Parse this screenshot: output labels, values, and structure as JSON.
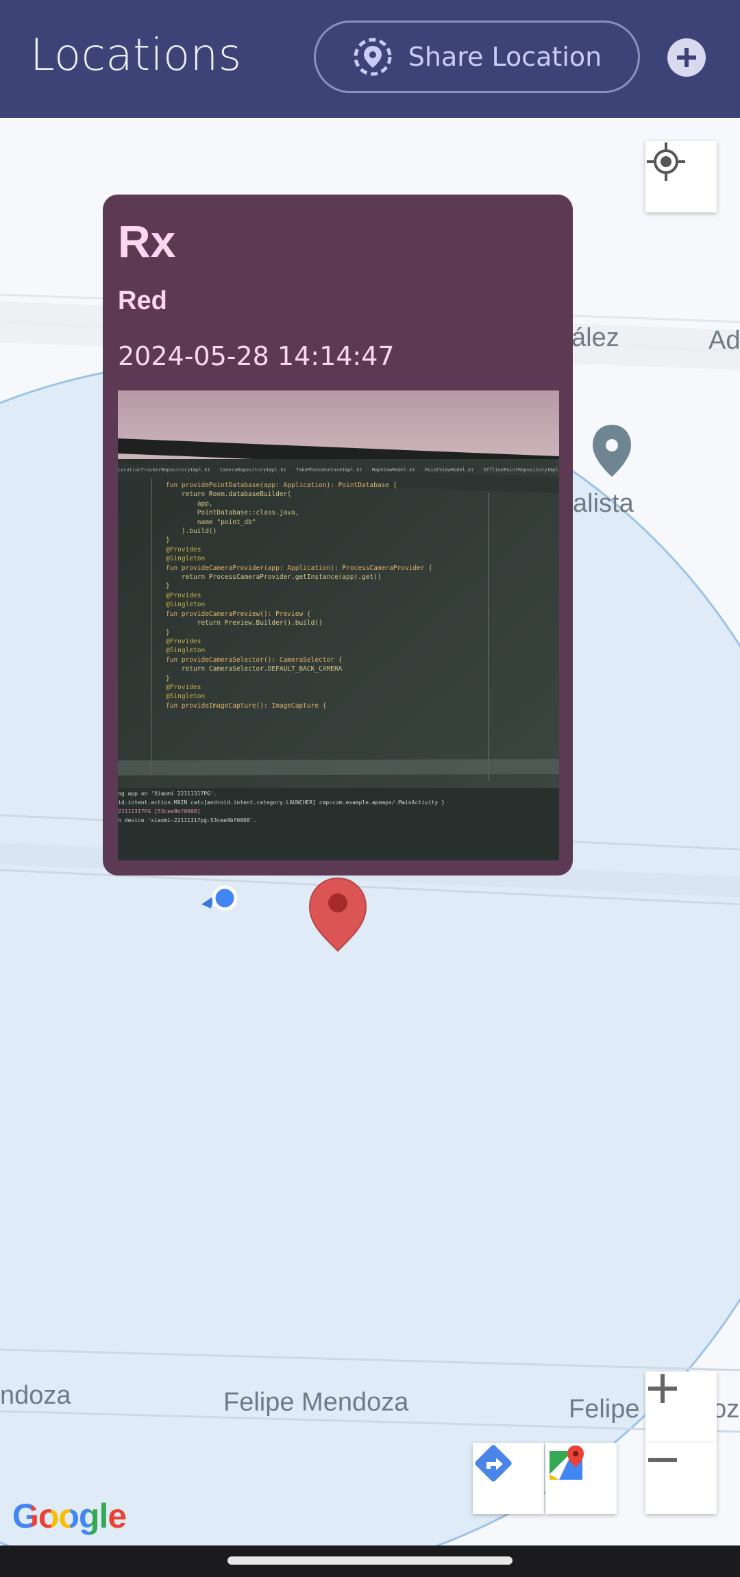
{
  "appbar": {
    "title": "Locations",
    "share_label": "Share Location",
    "share_icon": "location-target-icon",
    "add_icon": "plus-icon"
  },
  "map": {
    "street_labels": [
      "ález",
      "Ad",
      "alista",
      "ndoza",
      "Felipe Mendoza",
      "Felipe Mendoz"
    ],
    "attribution": "Google",
    "controls": {
      "my_location_icon": "crosshair-icon",
      "directions_icon": "directions-icon",
      "maps_icon": "google-maps-icon",
      "zoom_in_icon": "plus-icon",
      "zoom_out_icon": "minus-icon"
    }
  },
  "popup": {
    "name": "Rx",
    "color": "Red",
    "timestamp": "2024-05-28 14:14:47",
    "photo": {
      "tabs": [
        "LocationTrackerRepositoryImpl.kt",
        "CameraRepositoryImpl.kt",
        "TakePhotoUseCaseImpl.kt",
        "MapViewModel.kt",
        "PointViewModel.kt",
        "OfflinePointRepositoryImpl.kt"
      ],
      "code": [
        "fun providePointDatabase(app: Application): PointDatabase {",
        "    return Room.databaseBuilder(",
        "        app,",
        "        PointDatabase::class.java,",
        "        name \"point_db\"",
        "    ).build()",
        "}",
        "",
        "@Provides",
        "@Singleton",
        "fun provideCameraProvider(app: Application): ProcessCameraProvider {",
        "    return ProcessCameraProvider.getInstance(app).get()",
        "}",
        "",
        "@Provides",
        "@Singleton",
        "fun provideCameraPreview(): Preview {",
        "        return Preview.Builder().build()",
        "}",
        "",
        "@Provides",
        "@Singleton",
        "fun provideCameraSelector(): CameraSelector {",
        "    return CameraSelector.DEFAULT_BACK_CAMERA",
        "}",
        "",
        "@Provides",
        "@Singleton",
        "fun provideImageCapture(): ImageCapture {"
      ],
      "console": [
        "ng app on 'Xiaomi 22111317PG'.",
        "id.intent.action.MAIN cat=[android.intent.category.LAUNCHER] cmp=com.example.apmaps/.MainActivity }",
        "",
        "22111317PG [53cee9bf0008]",
        "n device 'xiaomi-22111317pg-53cee9bf0008'."
      ]
    }
  },
  "colors": {
    "appbar": "#3e4377",
    "popup": "#5d3a54",
    "popup_text": "#ffd6ef",
    "marker": "#db5555",
    "accuracy_circle": "#dfecf8"
  }
}
